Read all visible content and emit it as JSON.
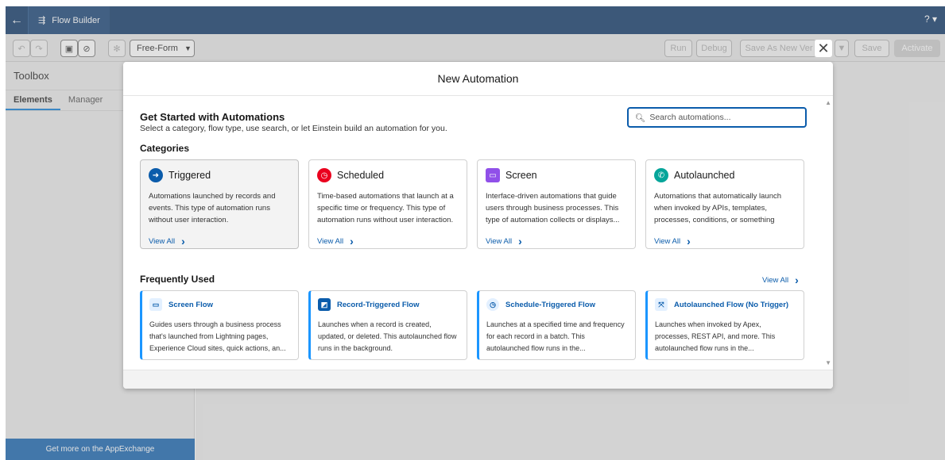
{
  "topbar": {
    "back_icon": "arrow-left-icon",
    "app_icon": "flow-icon",
    "app_name": "Flow Builder",
    "help": "? ▾"
  },
  "toolbar": {
    "layout_select": "Free-Form",
    "buttons": {
      "run": "Run",
      "debug": "Debug",
      "save_as": "Save As New Ver",
      "save": "Save",
      "activate": "Activate"
    }
  },
  "left_panel": {
    "title": "Toolbox",
    "tabs": [
      "Elements",
      "Manager"
    ],
    "footer": "Get more on the AppExchange"
  },
  "modal": {
    "title": "New Automation",
    "close": "✕",
    "heading": "Get Started with Automations",
    "subheading": "Select a category, flow type, use search, or let Einstein build an automation for you.",
    "search_placeholder": "Search automations...",
    "categories_title": "Categories",
    "categories": [
      {
        "name": "Triggered",
        "icon": "triggered-icon",
        "color": "#0b5cab",
        "desc": "Automations launched by records and events. This type of automation runs without user interaction.",
        "link": "View All"
      },
      {
        "name": "Scheduled",
        "icon": "clock-icon",
        "color": "#ea001e",
        "desc": "Time-based automations that launch at a specific time or frequency. This type of automation runs without user interaction.",
        "link": "View All"
      },
      {
        "name": "Screen",
        "icon": "screen-icon",
        "color": "#9050e9",
        "desc": "Interface-driven automations that guide users through business processes. This type of automation collects or displays...",
        "link": "View All"
      },
      {
        "name": "Autolaunched",
        "icon": "autolaunch-icon",
        "color": "#06a59a",
        "desc": "Automations that automatically launch when invoked by APIs, templates, processes, conditions, or something else...",
        "link": "View All"
      }
    ],
    "frequent_title": "Frequently Used",
    "frequent_viewall": "View All",
    "frequent": [
      {
        "name": "Screen Flow",
        "icon": "screen-icon",
        "desc": "Guides users through a business process that's launched from Lightning pages, Experience Cloud sites, quick actions, an..."
      },
      {
        "name": "Record-Triggered Flow",
        "icon": "record-icon",
        "desc": "Launches when a record is created, updated, or deleted. This autolaunched flow runs in the background."
      },
      {
        "name": "Schedule-Triggered Flow",
        "icon": "clock-icon",
        "desc": "Launches at a specified time and frequency for each record in a batch. This autolaunched flow runs in the..."
      },
      {
        "name": "Autolaunched Flow (No Trigger)",
        "icon": "autolaunch-icon",
        "desc": "Launches when invoked by Apex, processes, REST API, and more. This autolaunched flow runs in the..."
      }
    ]
  }
}
